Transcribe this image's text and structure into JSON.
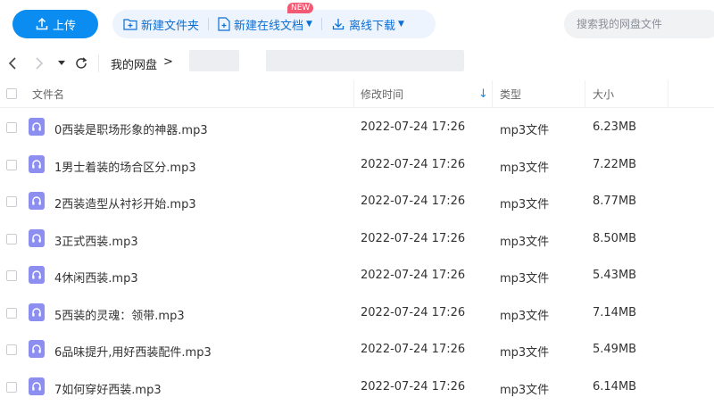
{
  "toolbar": {
    "upload_label": "上传",
    "new_folder_label": "新建文件夹",
    "new_online_doc_label": "新建在线文档",
    "new_badge": "NEW",
    "offline_download_label": "离线下载"
  },
  "search": {
    "placeholder": "搜索我的网盘文件"
  },
  "breadcrumb": {
    "root": "我的网盘",
    "separator": ">"
  },
  "table": {
    "headers": {
      "name": "文件名",
      "modified": "修改时间",
      "sort_indicator": "↓",
      "type": "类型",
      "size": "大小"
    },
    "rows": [
      {
        "name": "0西装是职场形象的神器.mp3",
        "modified": "2022-07-24 17:26",
        "type": "mp3文件",
        "size": "6.23MB"
      },
      {
        "name": "1男士着装的场合区分.mp3",
        "modified": "2022-07-24 17:26",
        "type": "mp3文件",
        "size": "7.22MB"
      },
      {
        "name": "2西装造型从衬衫开始.mp3",
        "modified": "2022-07-24 17:26",
        "type": "mp3文件",
        "size": "8.77MB"
      },
      {
        "name": "3正式西装.mp3",
        "modified": "2022-07-24 17:26",
        "type": "mp3文件",
        "size": "8.50MB"
      },
      {
        "name": "4休闲西装.mp3",
        "modified": "2022-07-24 17:26",
        "type": "mp3文件",
        "size": "5.43MB"
      },
      {
        "name": "5西装的灵魂：领带.mp3",
        "modified": "2022-07-24 17:26",
        "type": "mp3文件",
        "size": "7.14MB"
      },
      {
        "name": "6品味提升,用好西装配件.mp3",
        "modified": "2022-07-24 17:26",
        "type": "mp3文件",
        "size": "5.49MB"
      },
      {
        "name": "7如何穿好西装.mp3",
        "modified": "2022-07-24 17:26",
        "type": "mp3文件",
        "size": "6.14MB"
      }
    ]
  },
  "colors": {
    "accent": "#0a8cf0",
    "file_icon": "#8d8ff0",
    "badge": "#f25a74"
  }
}
